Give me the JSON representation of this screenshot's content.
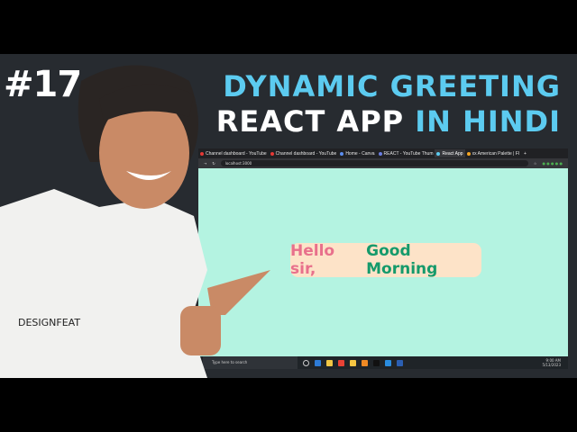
{
  "thumbnail": {
    "episode": "#17",
    "title_line1": "DYNAMIC GREETING",
    "title_line2_a": "REACT APP",
    "title_line2_b": "IN HINDI",
    "shirt_text": "DESIGNFEAT"
  },
  "browser": {
    "tabs": [
      {
        "label": "Channel dashboard - YouTube",
        "color": "#e53935"
      },
      {
        "label": "Channel dashboard - YouTube",
        "color": "#e53935"
      },
      {
        "label": "Home - Canva",
        "color": "#5b8def"
      },
      {
        "label": "REACT - YouTube Thum",
        "color": "#6a7de0"
      },
      {
        "label": "React App",
        "color": "#5ccbf0",
        "active": true
      },
      {
        "label": "xx American Palette | Fl",
        "color": "#f5a623"
      }
    ],
    "url": "localhost:3000",
    "greeting": {
      "prefix": "Hello sir,",
      "message": "Good Morning"
    },
    "taskbar": {
      "search_placeholder": "Type here to search",
      "time": "9:00 AM",
      "date": "5/13/2023"
    }
  },
  "colors": {
    "accent": "#5ccbf0",
    "page_bg": "#b4f3e1",
    "pill_bg": "#fde3c8",
    "hello": "#e8708c",
    "morning": "#159a6b"
  }
}
